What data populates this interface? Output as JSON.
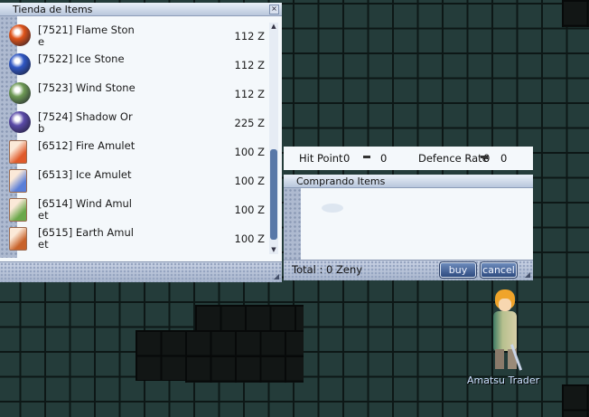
{
  "shop": {
    "title": "Tienda de Items",
    "close_glyph": "×",
    "currency_suffix": "Z",
    "items": [
      {
        "id": "7521",
        "name": "Flame Stone",
        "price": "112 Z",
        "icon": "fire-orb-icon",
        "color": "#e0541a"
      },
      {
        "id": "7522",
        "name": "Ice Stone",
        "price": "112 Z",
        "icon": "ice-orb-icon",
        "color": "#2f57c4"
      },
      {
        "id": "7523",
        "name": "Wind Stone",
        "price": "112 Z",
        "icon": "wind-orb-icon",
        "color": "#6e9a55"
      },
      {
        "id": "7524",
        "name": "Shadow Orb",
        "price": "225 Z",
        "icon": "shadow-orb-icon",
        "color": "#5a4aa8"
      },
      {
        "id": "6512",
        "name": "Fire Amulet",
        "price": "100 Z",
        "icon": "fire-amulet-icon",
        "color": "#e05a2a"
      },
      {
        "id": "6513",
        "name": "Ice Amulet",
        "price": "100 Z",
        "icon": "ice-amulet-icon",
        "color": "#5a7ed8"
      },
      {
        "id": "6514",
        "name": "Wind Amulet",
        "price": "100 Z",
        "icon": "wind-amulet-icon",
        "color": "#6aa84a"
      },
      {
        "id": "6515",
        "name": "Earth Amulet",
        "price": "100 Z",
        "icon": "earth-amulet-icon",
        "color": "#c8622a"
      }
    ]
  },
  "stats": {
    "hit_label": "Hit Point",
    "hit_value": "0",
    "hit_change": "0",
    "def_label": "Defence Rate",
    "def_value": "0",
    "def_change": "0"
  },
  "buy": {
    "title": "Comprando Items",
    "total": "Total : 0 Zeny",
    "buy_label": "buy",
    "cancel_label": "cancel"
  },
  "npc": {
    "name": "Amatsu Trader"
  }
}
